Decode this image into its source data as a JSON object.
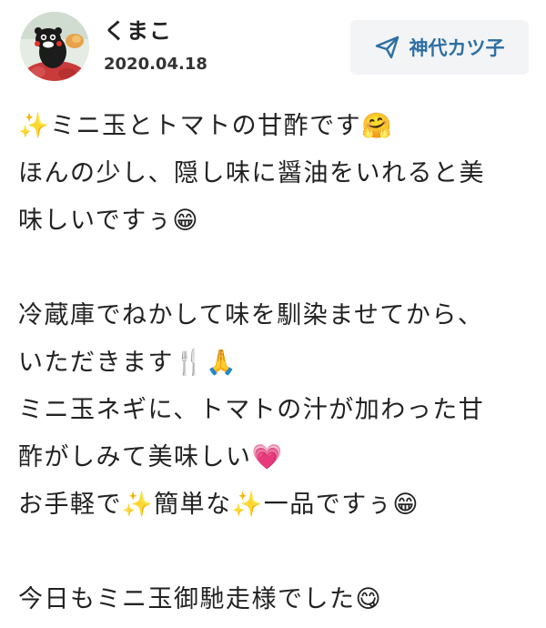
{
  "post": {
    "username": "くまこ",
    "date": "2020.04.18",
    "source_label": "神代カツ子",
    "source_icon": "send-icon",
    "accent_color": "#2d6fa3",
    "avatar_icon": "kumamon-avatar-icon"
  },
  "body": {
    "lines": [
      "✨ミニ玉とトマトの甘酢です🤗",
      "ほんの少し、隠し味に醤油をいれると美",
      "味しいですぅ😁",
      "",
      "冷蔵庫でねかして味を馴染ませてから、",
      "いただきます🍴🙏",
      "ミニ玉ネギに、トマトの汁が加わった甘",
      "酢がしみて美味しい💗",
      "お手軽で✨簡単な✨一品ですぅ😁",
      "",
      "今日もミニ玉御馳走様でした😋"
    ]
  }
}
